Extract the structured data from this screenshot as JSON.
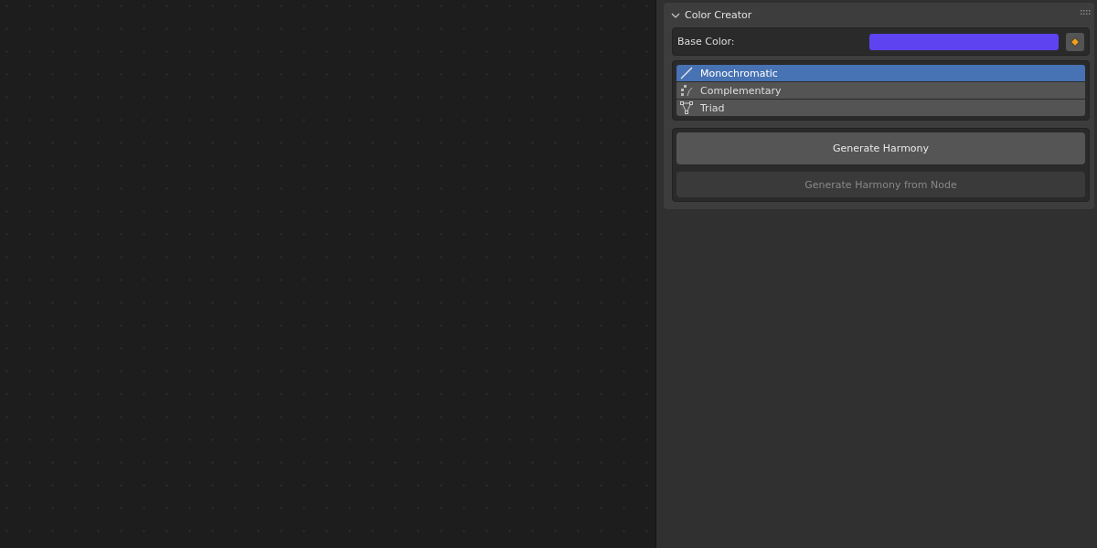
{
  "panel": {
    "title": "Color Creator",
    "expanded": true
  },
  "base_color": {
    "label": "Base Color:",
    "color": "#5e43f0"
  },
  "harmonies": [
    {
      "label": "Monochromatic",
      "kind": "line",
      "selected": true
    },
    {
      "label": "Complementary",
      "kind": "complementary",
      "selected": false
    },
    {
      "label": "Triad",
      "kind": "triad",
      "selected": false
    }
  ],
  "buttons": [
    {
      "label": "Generate Harmony",
      "disabled": false
    },
    {
      "label": "Generate Harmony from Node",
      "disabled": true
    }
  ]
}
